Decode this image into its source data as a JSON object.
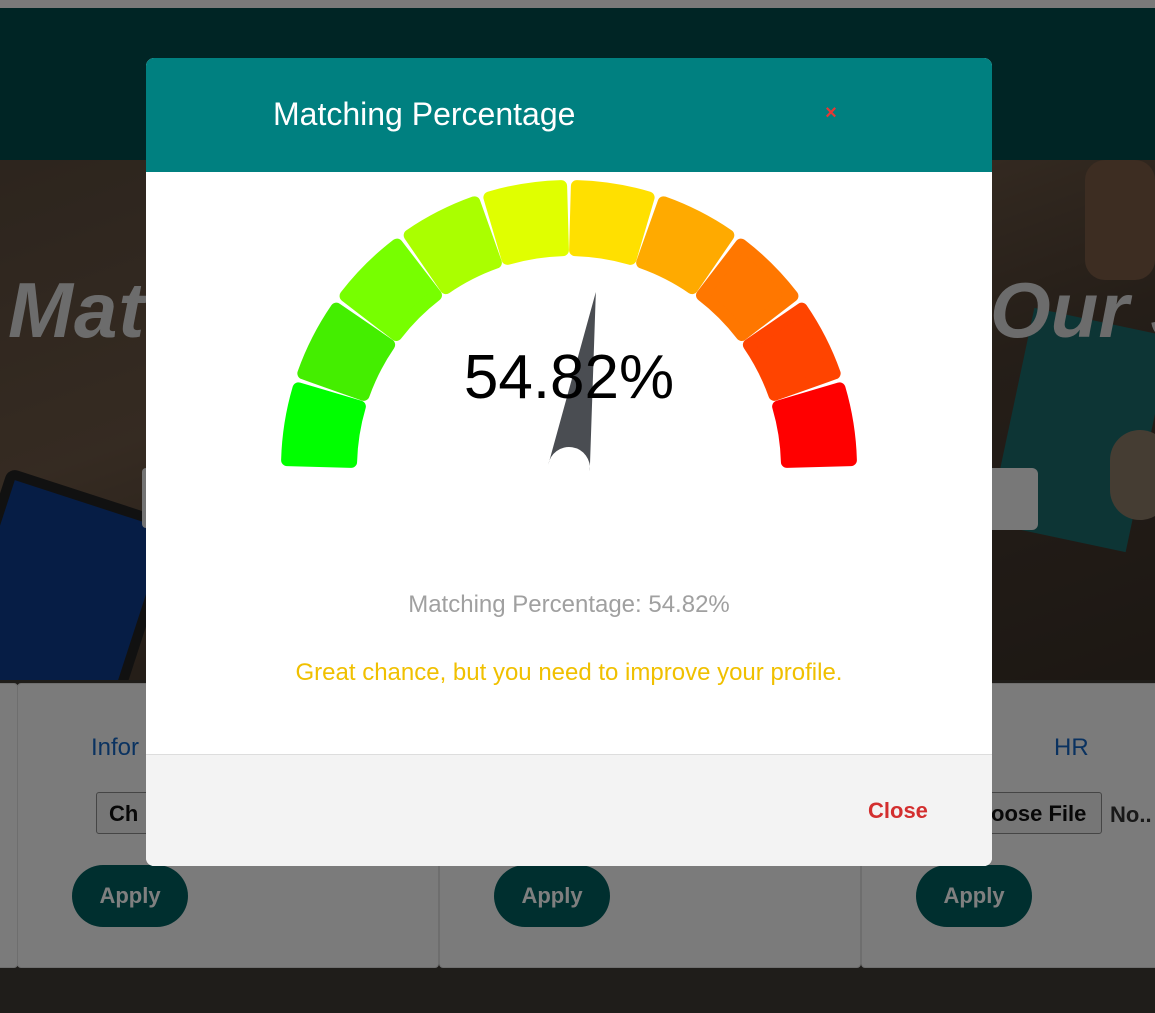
{
  "hero": {
    "title_left": "Mat",
    "title_right": "Our J"
  },
  "cards": [
    {
      "title": "Infor",
      "file_button": "Ch",
      "apply": "Apply"
    },
    {
      "apply": "Apply"
    },
    {
      "title": "HR",
      "file_button": "oose File",
      "no_file": "No..",
      "apply": "Apply"
    }
  ],
  "modal": {
    "title": "Matching Percentage",
    "close_icon": "×",
    "gauge_value_text": "54.82%",
    "gauge_value": 54.82,
    "gauge_max": 100,
    "gauge_segment_colors": [
      "#00ff00",
      "#44ee00",
      "#77ff00",
      "#aaff00",
      "#e0ff00",
      "#ffe000",
      "#ffaa00",
      "#ff7700",
      "#ff4400",
      "#ff0000"
    ],
    "needle_color": "#4a4d52",
    "match_line": "Matching Percentage: 54.82%",
    "advice": "Great chance, but you need to improve your profile.",
    "close_label": "Close"
  }
}
